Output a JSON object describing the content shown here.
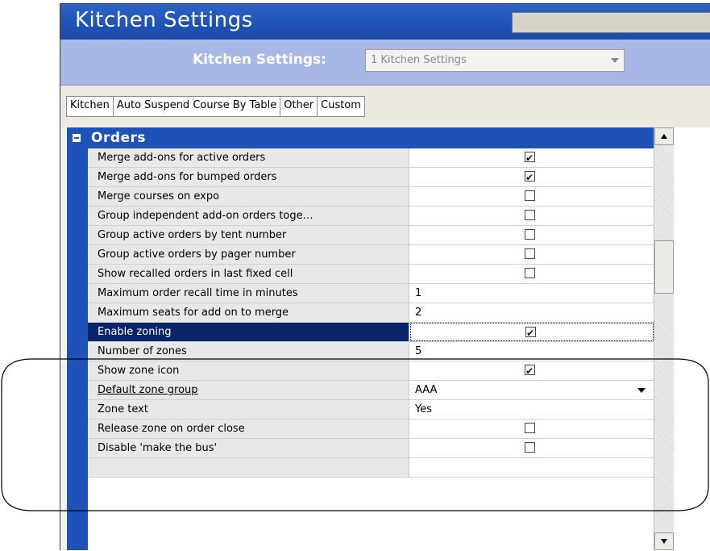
{
  "window": {
    "title": "Kitchen Settings"
  },
  "selector": {
    "label": "Kitchen Settings:",
    "value": "1 Kitchen Settings"
  },
  "tabs": [
    {
      "label": "Kitchen",
      "active": true
    },
    {
      "label": "Auto Suspend Course By Table",
      "active": false
    },
    {
      "label": "Other",
      "active": false
    },
    {
      "label": "Custom",
      "active": false
    }
  ],
  "category": {
    "label": "Orders"
  },
  "rows": [
    {
      "name": "Merge add-ons for active orders",
      "type": "checkbox",
      "checked": true
    },
    {
      "name": "Merge add-ons for bumped orders",
      "type": "checkbox",
      "checked": true
    },
    {
      "name": "Merge courses on expo",
      "type": "checkbox",
      "checked": false
    },
    {
      "name": "Group independent add-on orders toge…",
      "type": "checkbox",
      "checked": false
    },
    {
      "name": "Group active orders by tent number",
      "type": "checkbox",
      "checked": false
    },
    {
      "name": "Group active orders by pager number",
      "type": "checkbox",
      "checked": false
    },
    {
      "name": "Show recalled orders in last fixed cell",
      "type": "checkbox",
      "checked": false
    },
    {
      "name": "Maximum order recall time in minutes",
      "type": "text",
      "value": "1"
    },
    {
      "name": "Maximum seats for add on to merge",
      "type": "text",
      "value": "2"
    },
    {
      "name": "Enable zoning",
      "type": "checkbox",
      "checked": true,
      "selected": true
    },
    {
      "name": "Number of zones",
      "type": "text",
      "value": "5"
    },
    {
      "name": "Show zone icon",
      "type": "checkbox",
      "checked": true
    },
    {
      "name": "Default zone group",
      "type": "dropdown",
      "value": "AAA",
      "underlined": true
    },
    {
      "name": "Zone text",
      "type": "text",
      "value": "Yes"
    },
    {
      "name": "Release zone on order close",
      "type": "checkbox",
      "checked": false
    },
    {
      "name": "Disable 'make the bus'",
      "type": "checkbox",
      "checked": false
    },
    {
      "name": "",
      "type": "text",
      "value": ""
    }
  ],
  "colors": {
    "title_blue": "#1f52b6",
    "selection": "#0a246a",
    "selector_band": "#a7b8e6"
  }
}
